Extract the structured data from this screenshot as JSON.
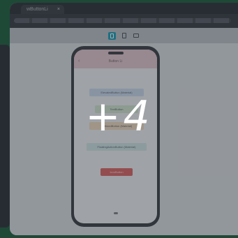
{
  "browser": {
    "tab_title": "wButtonLi",
    "tab_close": "×",
    "url": ""
  },
  "device_toolbar": {
    "devices": [
      "mobile-icon",
      "tablet-icon",
      "desktop-icon"
    ],
    "active": "mobile",
    "accent": "#1d9bb5"
  },
  "app": {
    "title": "Button Li",
    "back_glyph": "‹",
    "buttons": [
      {
        "label": "ElevatedButton (Material)",
        "color": "#c9d7ec"
      },
      {
        "label": "TextButton",
        "color": "#cfe3cf"
      },
      {
        "label": "OutlinedButton (Material)",
        "color": "#eed8bf"
      },
      {
        "label": "FloatingActionButton (Material)",
        "color": "#cde2e4"
      },
      {
        "label": "IconButton",
        "color": "#d96464"
      }
    ]
  },
  "overlay": {
    "more_count": "+4"
  }
}
